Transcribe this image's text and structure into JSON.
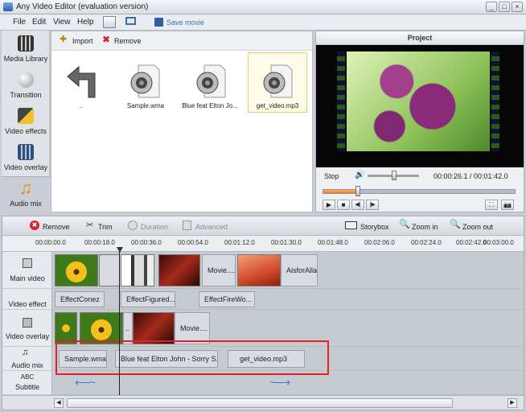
{
  "window": {
    "title": "Any Video Editor (evaluation version)"
  },
  "menu": [
    "File",
    "Edit",
    "View",
    "Help"
  ],
  "toolbar": {
    "save_label": "Save movie"
  },
  "sidebar": {
    "items": [
      {
        "label": "Media Library"
      },
      {
        "label": "Transition"
      },
      {
        "label": "Video effects"
      },
      {
        "label": "Video overlay"
      },
      {
        "label": "Audio mix"
      }
    ]
  },
  "browser": {
    "import_label": "Import",
    "remove_label": "Remove",
    "files": [
      {
        "name": ".."
      },
      {
        "name": "Sample.wma"
      },
      {
        "name": "Blue feat Elton Jo..."
      },
      {
        "name": "get_video.mp3"
      }
    ]
  },
  "project": {
    "title": "Project",
    "stop_label": "Stop",
    "time": "00:00:26.1 / 00:01:42.0",
    "progress": 0.18
  },
  "timeline": {
    "remove_label": "Remove",
    "trim_label": "Trim",
    "duration_label": "Duration",
    "advanced_label": "Advanced",
    "storybox_label": "Storybox",
    "zoomin_label": "Zoom in",
    "zoomout_label": "Zoom out",
    "ticks": [
      "00:00:00.0",
      "00:00:18.0",
      "00:00:36.0",
      "00:00:54.0",
      "00:01:12.0",
      "00:01:30.0",
      "00:01:48.0",
      "00:02:06.0",
      "00:02:24.0",
      "00:02:42.0",
      "00:03:00.0"
    ],
    "tracks": {
      "main_video": "Main video",
      "video_effect": "Video effect",
      "video_overlay": "Video overlay",
      "audio_mix": "Audio mix",
      "subtitle": "Subtitle",
      "abc": "ABC"
    },
    "main_clips": [
      "Movie....",
      "AisforAlla..."
    ],
    "effect_clips": [
      "EffectConez",
      "EffectFigured...",
      "EffectFireWo..."
    ],
    "overlay_clips": [
      "..",
      "Movie...."
    ],
    "audio_clips": [
      "Sample.wma",
      "Blue feat Elton John - Sorry S...",
      "get_video.mp3"
    ]
  },
  "colors": {
    "accent_red": "#e0202a",
    "selection_yellow": "#f0d060",
    "progress_orange": "#f07a20"
  }
}
